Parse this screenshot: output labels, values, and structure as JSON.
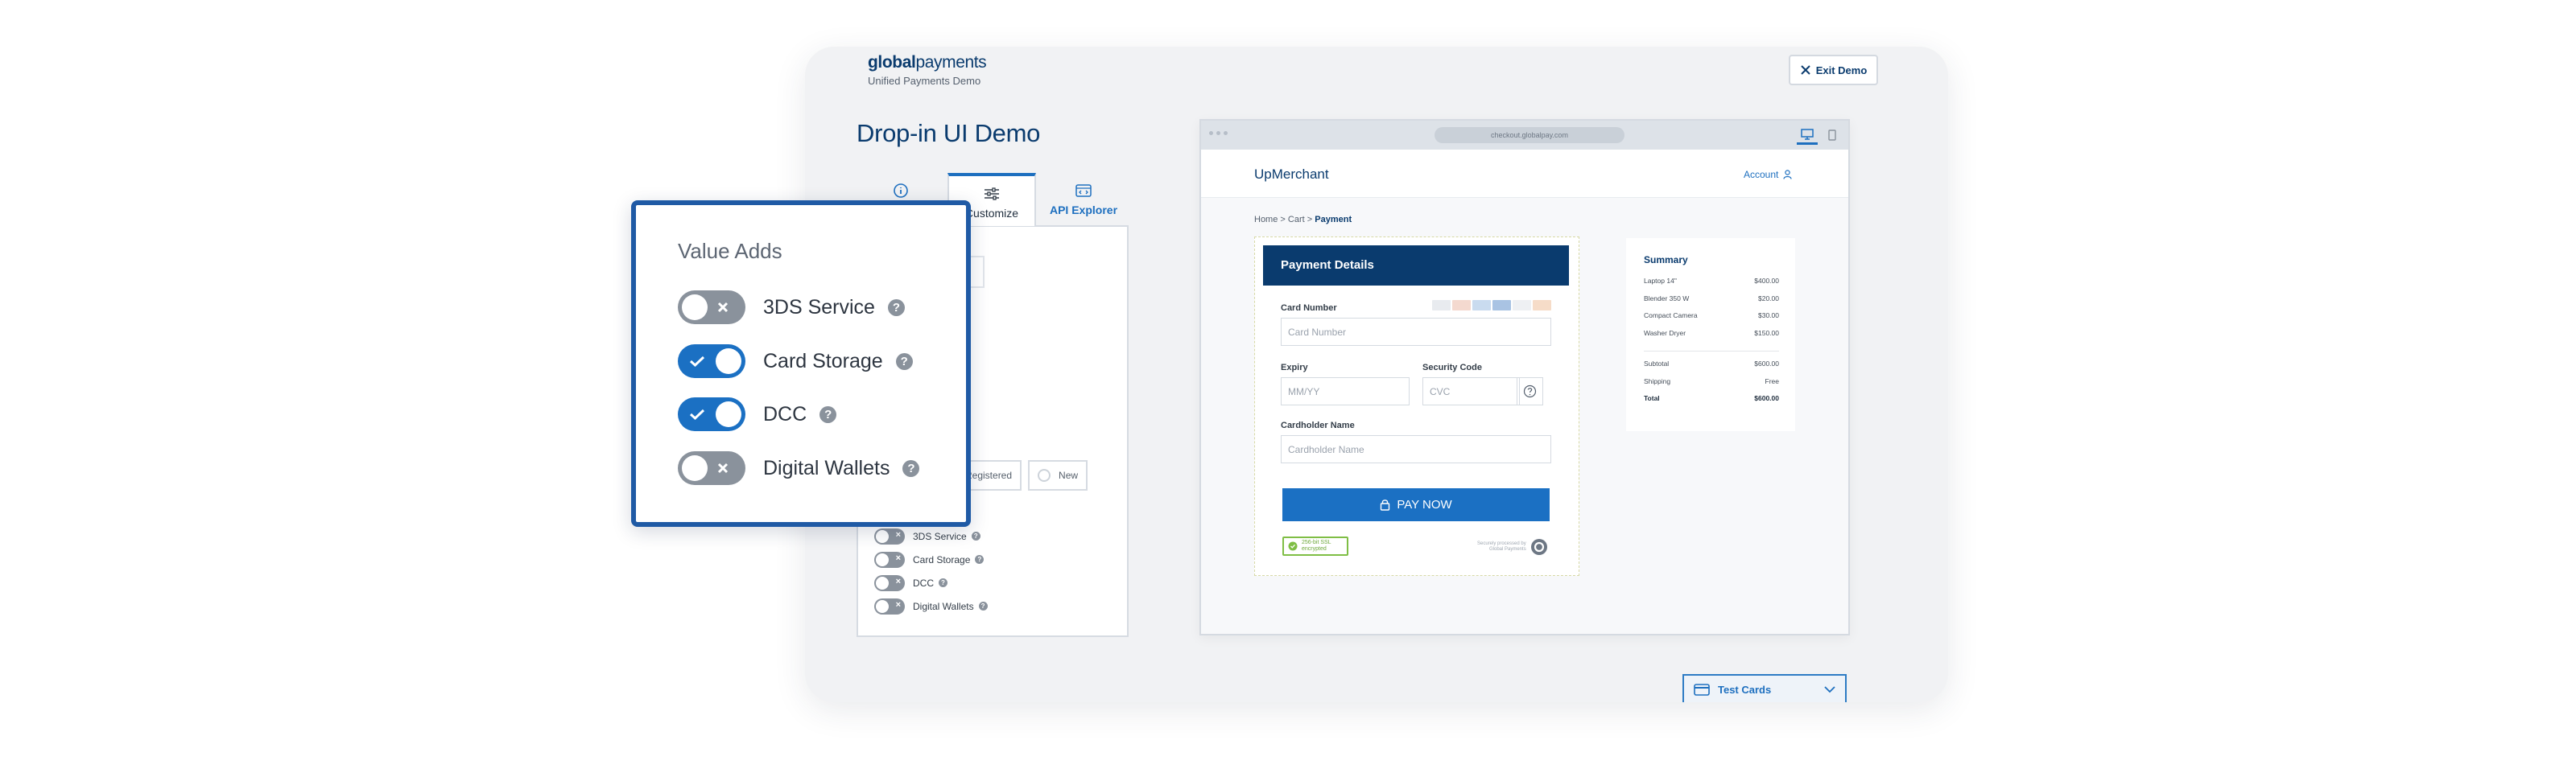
{
  "brand": {
    "logo_bold": "global",
    "logo_rest": "payments",
    "subtitle": "Unified Payments Demo"
  },
  "exit_button": {
    "label": "Exit Demo",
    "icon": "close-icon"
  },
  "page_title": "Drop-in UI Demo",
  "tabs": [
    {
      "label": "",
      "icon": "info-icon",
      "active": false
    },
    {
      "label": "Customize",
      "icon": "sliders-icon",
      "active": true
    },
    {
      "label": "API Explorer",
      "icon": "code-window-icon",
      "active": false
    }
  ],
  "shopper_options": [
    "Registered",
    "New"
  ],
  "small_value_adds": [
    {
      "label": "3DS Service",
      "on": false
    },
    {
      "label": "Card Storage",
      "on": false
    },
    {
      "label": "DCC",
      "on": false
    },
    {
      "label": "Digital Wallets",
      "on": false
    }
  ],
  "browser": {
    "url": "checkout.globalpay.com"
  },
  "merchant": {
    "name": "UpMerchant",
    "account_label": "Account"
  },
  "breadcrumb": {
    "home": "Home",
    "cart": "Cart",
    "current": "Payment",
    "separator": ">"
  },
  "payment": {
    "header": "Payment Details",
    "card_number_label": "Card Number",
    "card_number_placeholder": "Card Number",
    "expiry_label": "Expiry",
    "expiry_placeholder": "MM/YY",
    "security_label": "Security Code",
    "security_placeholder": "CVC",
    "cardholder_label": "Cardholder Name",
    "cardholder_placeholder": "Cardholder Name",
    "pay_button": "PAY NOW",
    "secure_badge_line1": "256-bit SSL",
    "secure_badge_line2": "encrypted",
    "secured_by_line1": "Securely processed by",
    "secured_by_line2": "Global Payments"
  },
  "summary": {
    "title": "Summary",
    "items": [
      {
        "name": "Laptop 14\"",
        "price": "$400.00"
      },
      {
        "name": "Blender 350 W",
        "price": "$20.00"
      },
      {
        "name": "Compact Camera",
        "price": "$30.00"
      },
      {
        "name": "Washer Dryer",
        "price": "$150.00"
      }
    ],
    "subtotal_label": "Subtotal",
    "subtotal": "$600.00",
    "shipping_label": "Shipping",
    "shipping": "Free",
    "total_label": "Total",
    "total": "$600.00"
  },
  "test_cards": {
    "label": "Test Cards"
  },
  "value_adds": {
    "title": "Value Adds",
    "items": [
      {
        "label": "3DS Service",
        "on": false
      },
      {
        "label": "Card Storage",
        "on": true
      },
      {
        "label": "DCC",
        "on": true
      },
      {
        "label": "Digital Wallets",
        "on": false
      }
    ]
  },
  "colors": {
    "brand_navy": "#0a3b6e",
    "accent_blue": "#1b70c3",
    "toggle_off": "#8a929c",
    "popup_border": "#1f5aa5"
  }
}
